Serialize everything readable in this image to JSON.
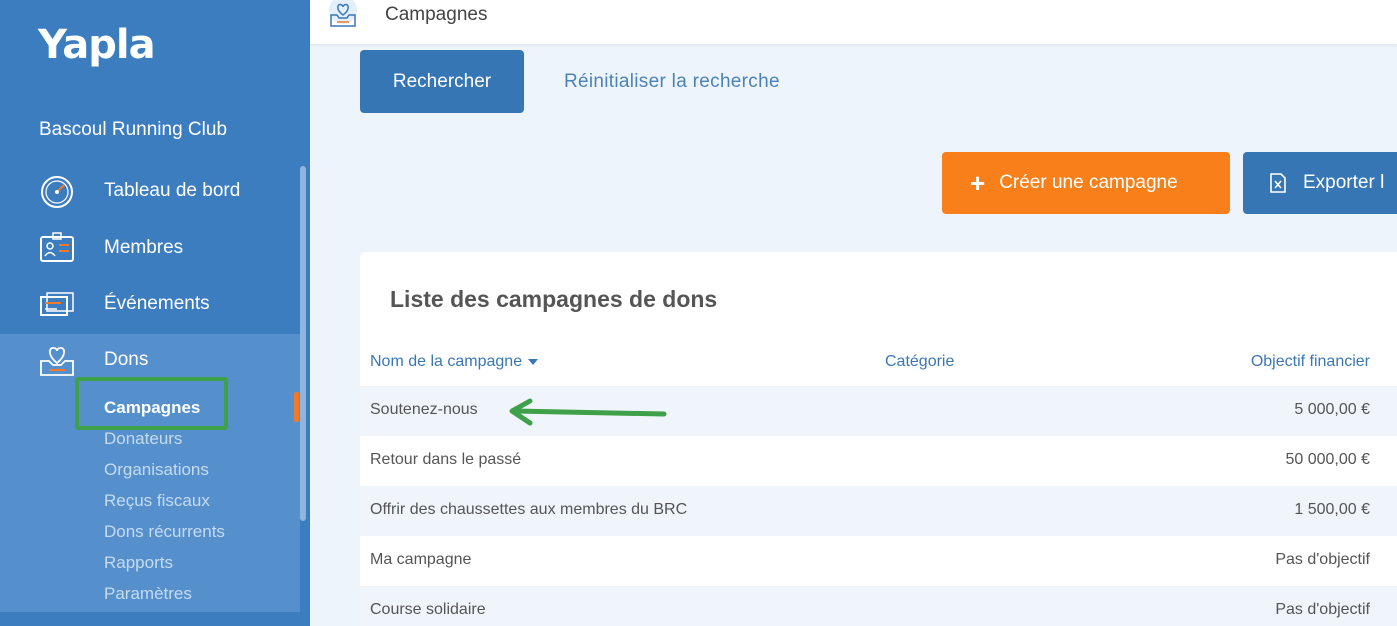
{
  "app": {
    "logo": "Yapla",
    "org_name": "Bascoul Running Club"
  },
  "sidebar": {
    "items": [
      {
        "label": "Tableau de bord",
        "icon": "dashboard-gauge-icon"
      },
      {
        "label": "Membres",
        "icon": "member-card-icon"
      },
      {
        "label": "Événements",
        "icon": "tickets-icon"
      },
      {
        "label": "Dons",
        "icon": "heart-box-icon"
      }
    ],
    "submenu": [
      {
        "label": "Campagnes",
        "active": true
      },
      {
        "label": "Donateurs"
      },
      {
        "label": "Organisations"
      },
      {
        "label": "Reçus fiscaux"
      },
      {
        "label": "Dons récurrents"
      },
      {
        "label": "Rapports"
      },
      {
        "label": "Paramètres"
      }
    ]
  },
  "topbar": {
    "title": "Campagnes",
    "icon": "heart-box-icon"
  },
  "toolbar": {
    "search_label": "Rechercher",
    "reset_label": "Réinitialiser la recherche",
    "create_label": "Créer une campagne",
    "export_label": "Exporter l"
  },
  "table": {
    "title": "Liste des campagnes de dons",
    "columns": [
      "Nom de la campagne",
      "Catégorie",
      "Objectif financier"
    ],
    "rows": [
      {
        "name": "Soutenez-nous",
        "category": "",
        "objective": "5 000,00 €"
      },
      {
        "name": "Retour dans le passé",
        "category": "",
        "objective": "50 000,00 €"
      },
      {
        "name": "Offrir des chaussettes aux membres du BRC",
        "category": "",
        "objective": "1 500,00 €"
      },
      {
        "name": "Ma campagne",
        "category": "",
        "objective": "Pas d'objectif"
      },
      {
        "name": "Course solidaire",
        "category": "",
        "objective": "Pas d'objectif"
      }
    ]
  },
  "colors": {
    "sidebar": "#3c7dc0",
    "primary_button": "#3676b4",
    "create_button": "#f87f1a",
    "annotation": "#3ea14a"
  }
}
